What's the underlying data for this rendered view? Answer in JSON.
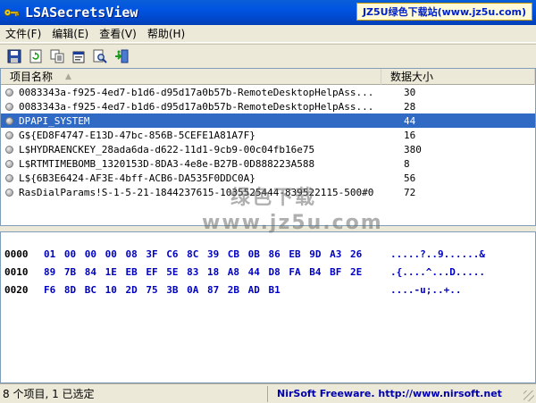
{
  "window": {
    "title": "LSASecretsView",
    "watermark": "JZ5U绿色下载站(www.jz5u.com)"
  },
  "menu": {
    "items": [
      "文件(F)",
      "编辑(E)",
      "查看(V)",
      "帮助(H)"
    ]
  },
  "toolbar": {
    "icons": [
      "save-icon",
      "refresh-icon",
      "copy-icon",
      "properties-icon",
      "find-icon",
      "exit-icon"
    ]
  },
  "list": {
    "columns": {
      "name": "项目名称",
      "size": "数据大小"
    },
    "rows": [
      {
        "name": "0083343a-f925-4ed7-b1d6-d95d17a0b57b-RemoteDesktopHelpAss...",
        "size": "30"
      },
      {
        "name": "0083343a-f925-4ed7-b1d6-d95d17a0b57b-RemoteDesktopHelpAss...",
        "size": "28"
      },
      {
        "name": "DPAPI_SYSTEM",
        "size": "44"
      },
      {
        "name": "G${ED8F4747-E13D-47bc-856B-5CEFE1A81A7F}",
        "size": "16"
      },
      {
        "name": "L$HYDRAENCKEY_28ada6da-d622-11d1-9cb9-00c04fb16e75",
        "size": "380"
      },
      {
        "name": "L$RTMTIMEBOMB_1320153D-8DA3-4e8e-B27B-0D888223A588",
        "size": "8"
      },
      {
        "name": "L${6B3E6424-AF3E-4bff-ACB6-DA535F0DDC0A}",
        "size": "56"
      },
      {
        "name": "RasDialParams!S-1-5-21-1844237615-1035525444-839522115-500#0",
        "size": "72"
      }
    ],
    "selected_index": 2
  },
  "hex": {
    "lines": [
      {
        "offset": "0000",
        "bytes": "01 00 00 00 08 3F C6 8C 39 CB 0B 86 EB 9D A3 26",
        "ascii": ".....?..9......&"
      },
      {
        "offset": "0010",
        "bytes": "89 7B 84 1E EB EF 5E 83 18 A8 44 D8 FA B4 BF 2E",
        "ascii": ".{....^...D....."
      },
      {
        "offset": "0020",
        "bytes": "F6 8D BC 10 2D 75 3B 0A 87 2B AD B1",
        "ascii": "....-u;..+.."
      }
    ]
  },
  "watermark_mid": {
    "line1": "绿色下载",
    "line2": "www.jz5u.com"
  },
  "status": {
    "left": "8 个项目, 1 已选定",
    "right": "NirSoft Freeware.  http://www.nirsoft.net"
  }
}
